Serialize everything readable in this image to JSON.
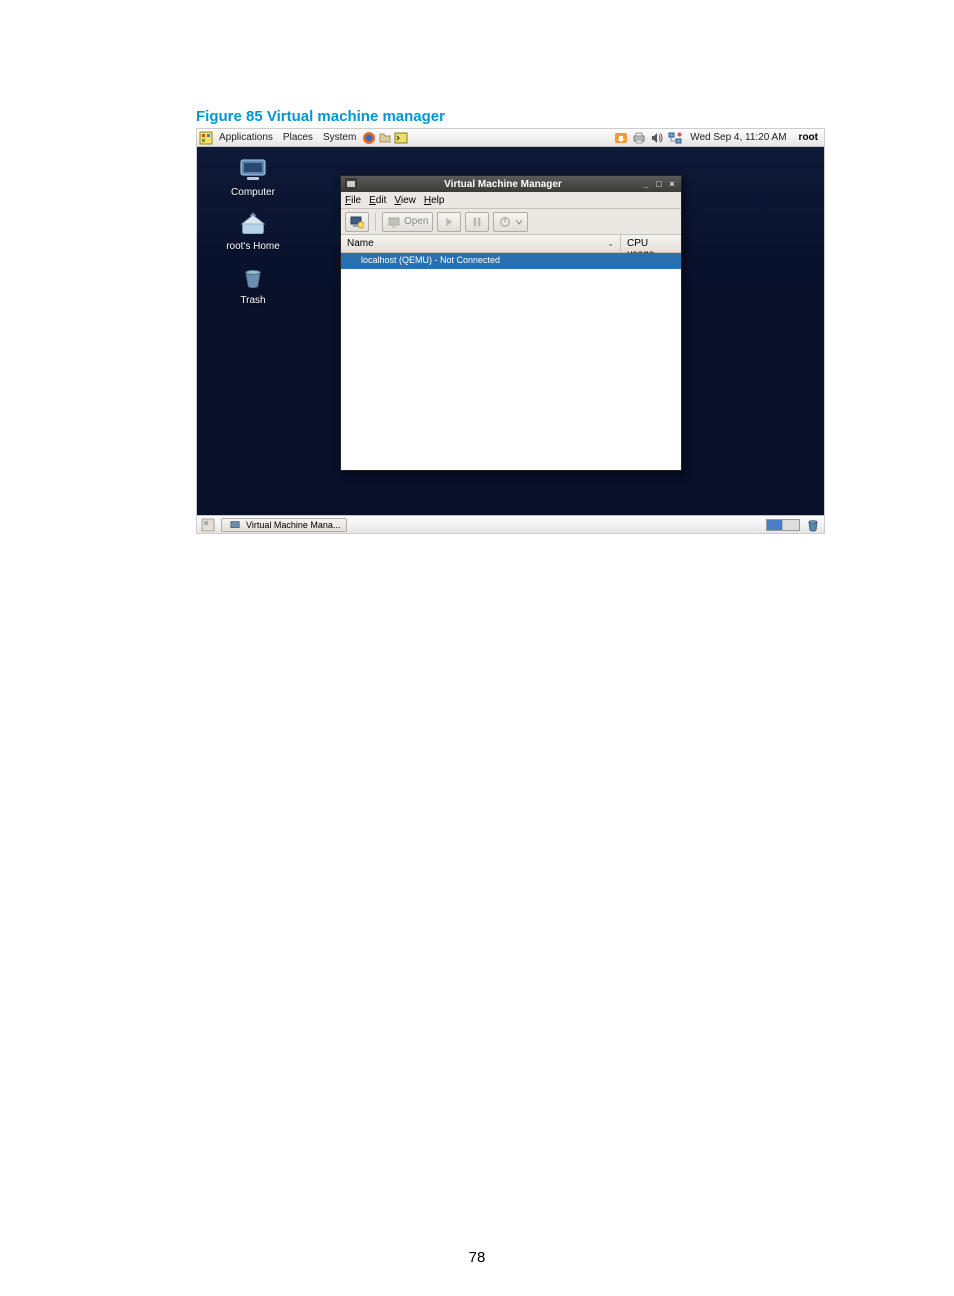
{
  "figure_caption": "Figure 85 Virtual machine manager",
  "page_number": "78",
  "top_panel": {
    "menus": {
      "applications": "Applications",
      "places": "Places",
      "system": "System"
    },
    "datetime": "Wed Sep  4, 11:20 AM",
    "username": "root"
  },
  "desktop_icons": {
    "computer": "Computer",
    "home": "root's Home",
    "trash": "Trash"
  },
  "vmm": {
    "title": "Virtual Machine Manager",
    "menus": {
      "file": "File",
      "edit": "Edit",
      "view": "View",
      "help": "Help"
    },
    "toolbar": {
      "open": "Open"
    },
    "columns": {
      "name": "Name",
      "cpu": "CPU usage"
    },
    "row_label": "localhost (QEMU) - Not Connected"
  },
  "taskbar": {
    "app_label": "Virtual Machine Mana..."
  }
}
